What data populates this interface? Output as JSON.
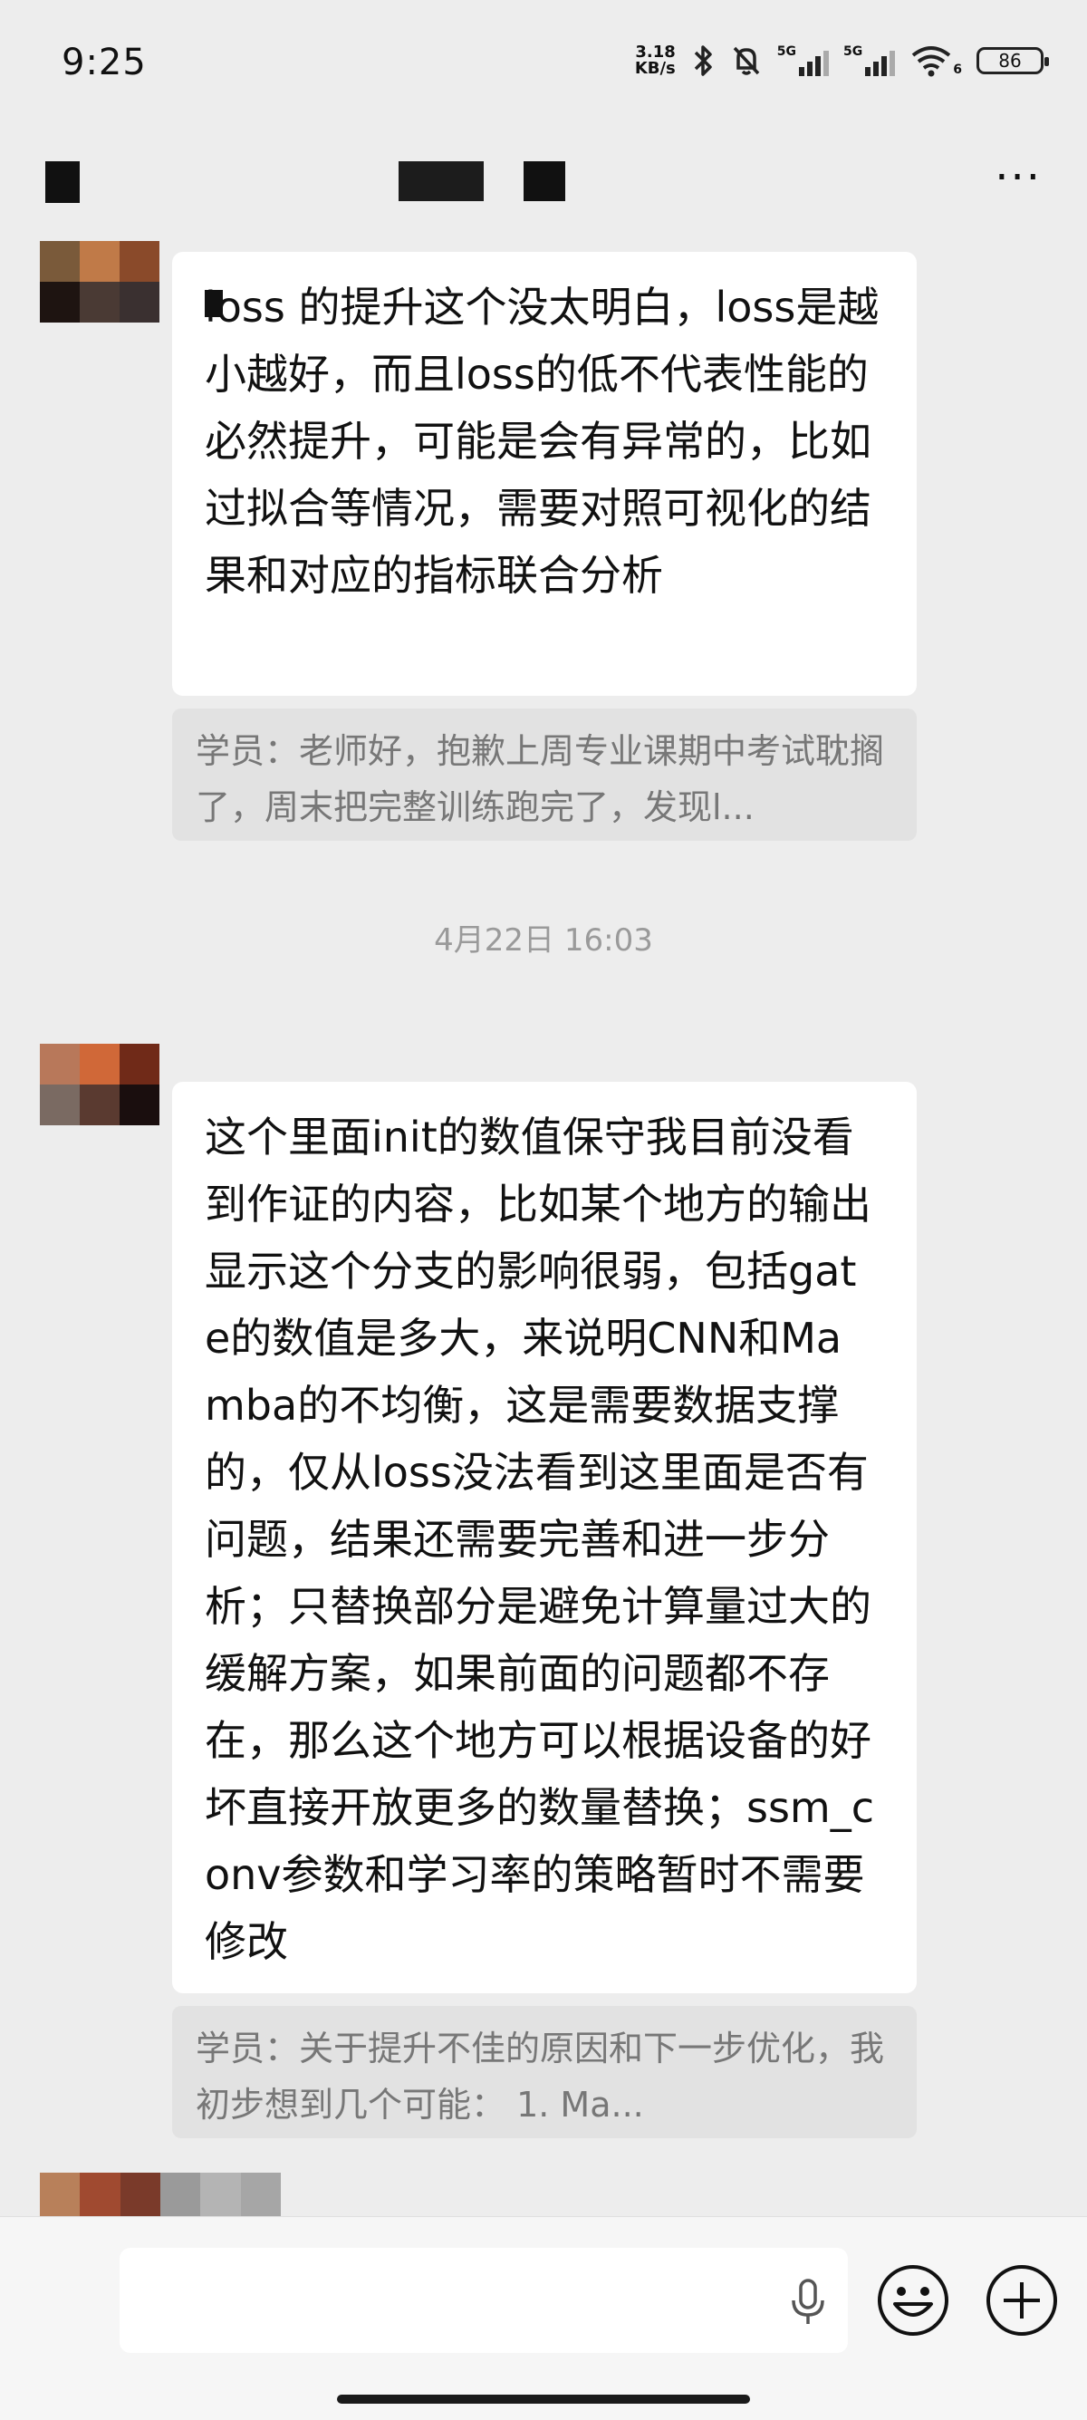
{
  "status_bar": {
    "time": "9:25",
    "net_speed_value": "3.18",
    "net_speed_unit": "KB/s",
    "sim1_label": "5G",
    "sim2_label": "5G",
    "wifi_label": "6",
    "battery": "86"
  },
  "nav": {
    "more_label": "···"
  },
  "messages": [
    {
      "text": "loss 的提升这个没太明白，loss是越小越好，而且loss的低不代表性能的必然提升，可能是会有异常的，比如过拟合等情况，需要对照可视化的结果和对应的指标联合分析",
      "quote": "学员：老师好，抱歉上周专业课期中考试耽搁了，周末把完整训练跑完了，发现l..."
    },
    {
      "text": "这个里面init的数值保守我目前没看到作证的内容，比如某个地方的输出显示这个分支的影响很弱，包括gate的数值是多大，来说明CNN和Mamba的不均衡，这是需要数据支撑的，仅从loss没法看到这里面是否有问题，结果还需要完善和进一步分析；只替换部分是避免计算量过大的缓解方案，如果前面的问题都不存在，那么这个地方可以根据设备的好坏直接开放更多的数量替换；ssm_conv参数和学习率的策略暂时不需要修改",
      "quote": "学员：关于提升不佳的原因和下一步优化，我初步想到几个可能： 1. Ma..."
    }
  ],
  "timestamp": "4月22日 16:03",
  "colors": {
    "background": "#ededed",
    "bubble": "#ffffff",
    "quote_bg": "#e2e2e2",
    "quote_text": "#777777",
    "timestamp_text": "#9a9a9a"
  },
  "icons": [
    "bluetooth-icon",
    "mute-bell-icon",
    "signal-icon",
    "wifi-icon",
    "battery-icon",
    "more-icon",
    "mic-icon",
    "emoji-icon",
    "plus-icon"
  ]
}
